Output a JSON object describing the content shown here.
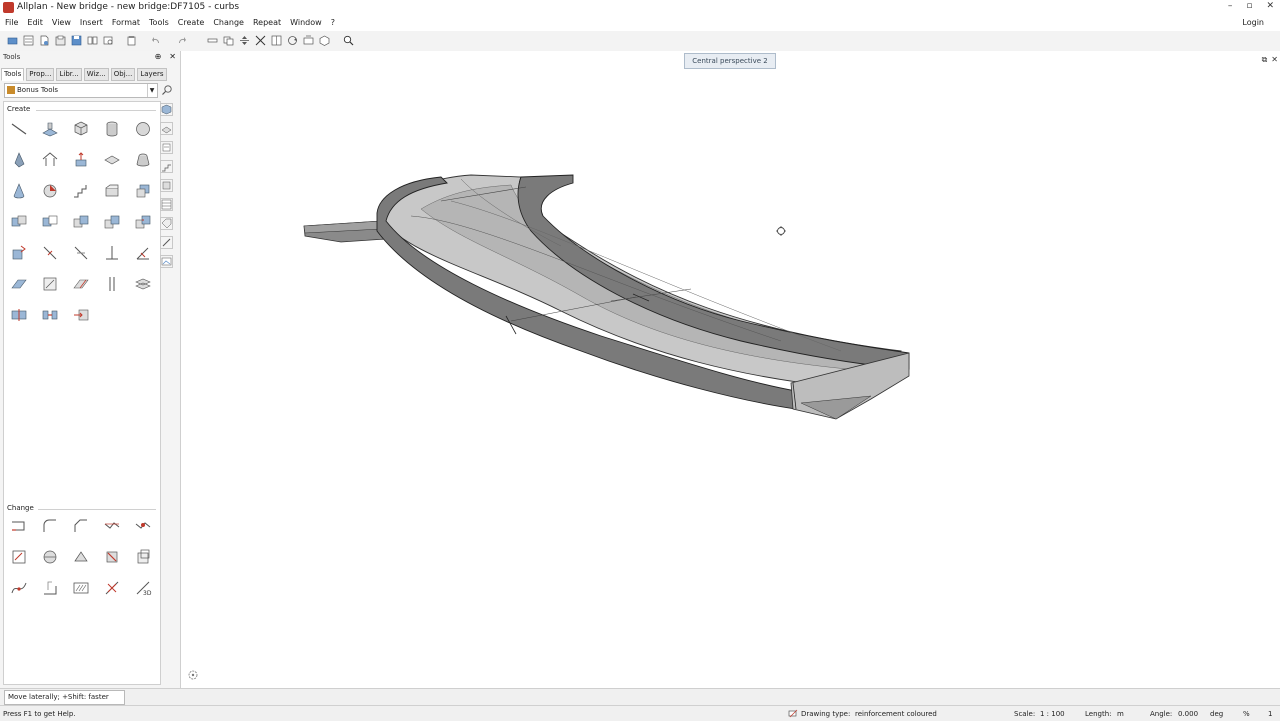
{
  "window": {
    "title": "Allplan - New bridge - new bridge:DF7105 - curbs",
    "controls": [
      "–",
      "▫",
      "✕"
    ]
  },
  "menu": [
    "File",
    "Edit",
    "View",
    "Insert",
    "Format",
    "Tools",
    "Create",
    "Change",
    "Repeat",
    "Window",
    "?"
  ],
  "login": "Login",
  "tools_panel": {
    "title": "Tools",
    "pin": "⊕",
    "close": "✕",
    "tabs": [
      "Tools",
      "Prop...",
      "Libr...",
      "Wiz...",
      "Obj...",
      "Layers"
    ],
    "palette": "Bonus Tools",
    "sections": {
      "create": "Create",
      "change": "Change"
    }
  },
  "viewport": {
    "view_tab": "Central perspective 2",
    "restore": "⧉",
    "close": "✕"
  },
  "dialog_line": {
    "prompt": "Move laterally; +Shift: faster"
  },
  "statusbar": {
    "help": "Press F1 to get Help.",
    "drawing_type_label": "Drawing type:",
    "drawing_type_value": "reinforcement coloured",
    "scale_label": "Scale:",
    "scale_value": "1 : 100",
    "length_label": "Length:",
    "length_unit": "m",
    "angle_label": "Angle:",
    "angle_value": "0.000",
    "angle_unit": "deg",
    "percent_label": "%",
    "percent_value": "1"
  },
  "colors": {
    "accent_red": "#c0392b",
    "toolbar_bg": "#f3f3f3",
    "panel_bg": "#f4f4f4",
    "view_tab_bg": "#e8edf3"
  }
}
